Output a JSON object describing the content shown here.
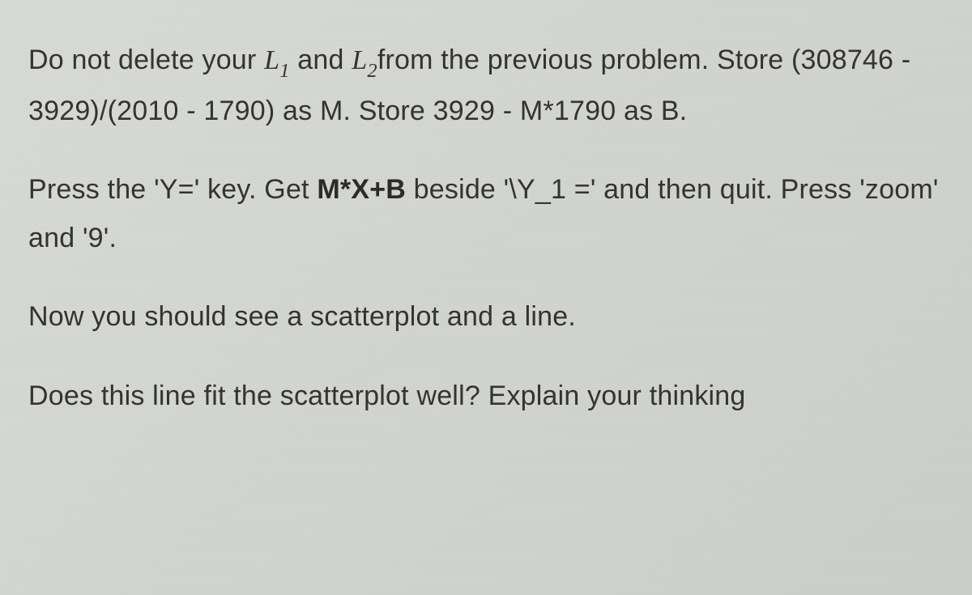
{
  "paragraphs": {
    "p1_part1": "Do not delete your ",
    "p1_L": "L",
    "p1_sub1": "1",
    "p1_and": " and ",
    "p1_sub2": "2",
    "p1_part2": "from the previous problem. Store (308746 - 3929)/(2010 - 1790) as M. Store 3929 - M*1790 as B.",
    "p2_part1": "Press the 'Y=' key. Get ",
    "p2_bold": "M*X+B",
    "p2_part2": " beside '\\Y_1 =' and then quit. Press 'zoom' and '9'.",
    "p3": "Now you should see a scatterplot and a line.",
    "p4": "Does this line fit the scatterplot well? Explain your thinking"
  }
}
